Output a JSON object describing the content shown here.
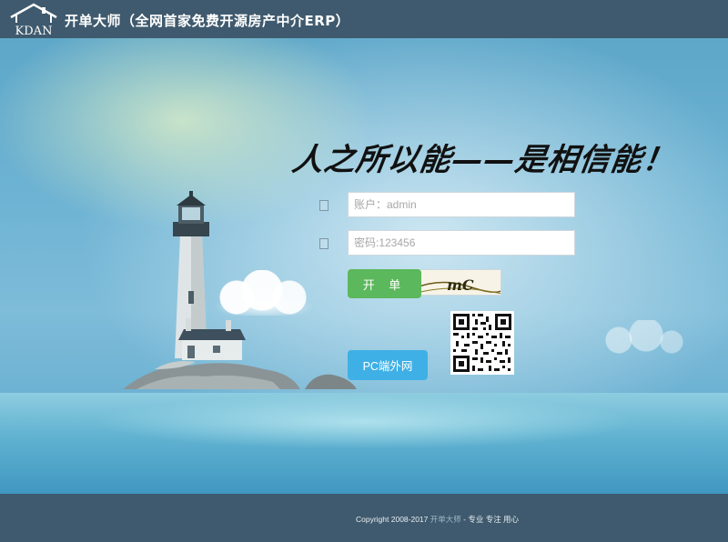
{
  "header": {
    "logo_text": "KDAN",
    "title": "开单大师（全网首家免费开源房产中介ERP）"
  },
  "slogan": "人之所以能——是相信能！",
  "login_form": {
    "account_placeholder": "账户：admin",
    "password_placeholder": "密码:123456",
    "captcha_value": "mc",
    "captcha_image_text": "mC",
    "login_label": "开 单",
    "pc_label": "PC端外网"
  },
  "footer": {
    "copyright_prefix": "Copyright 2008-2017 ",
    "copyright_brand": "开单大师",
    "copyright_suffix": " - 专业 专注 用心"
  },
  "icons": {
    "account": "user-icon",
    "password": "lock-icon"
  },
  "colors": {
    "header_bg": "#3f5a6e",
    "login_button": "#5cb85c",
    "pc_button": "#3fb0e6"
  }
}
